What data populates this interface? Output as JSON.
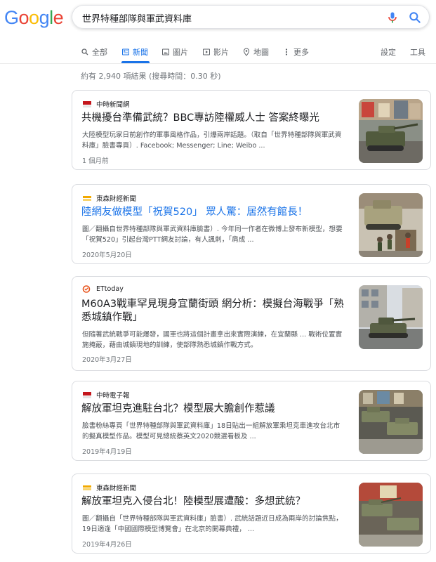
{
  "logo": {
    "letters": [
      "G",
      "o",
      "o",
      "g",
      "l",
      "e"
    ],
    "colors": [
      "#4285F4",
      "#EA4335",
      "#FBBC05",
      "#4285F4",
      "#34A853",
      "#EA4335"
    ]
  },
  "search": {
    "query": "世界特種部隊與軍武資料庫"
  },
  "tabs": {
    "all": "全部",
    "news": "新聞",
    "images": "圖片",
    "videos": "影片",
    "maps": "地圖",
    "more": "更多",
    "settings": "設定",
    "tools": "工具"
  },
  "stats": "約有 2,940 項結果 (搜尋時間：0.30 秒)",
  "results": [
    {
      "source": "中時新聞網",
      "title": "共機擾台準備武統？BBC專訪陸權威人士 答案終曝光",
      "snippet": "大陸模型玩家日前創作的軍事風格作品，引爆兩岸話題。（取自「世界特種部隊與軍武資料庫」臉書專頁）. Facebook; Messenger; Line; Weibo ...",
      "date": "1 個月前"
    },
    {
      "source": "東森財經新聞",
      "title": "陸網友做模型「祝賀520」 眾人驚：居然有館長！",
      "snippet": "圖／翻攝自世界特種部隊與軍武資料庫臉書）. 今年同一作者在微博上發布新模型，想要「祝賀520」引起台灣PTT網友討論，有人諷刺，「肩成 ...",
      "date": "2020年5月20日"
    },
    {
      "source": "ETtoday",
      "title": "M60A3戰車罕見現身宜蘭街頭 網分析：模擬台海戰爭「熟悉城鎮作戰」",
      "snippet": "但隨著武統戰爭可能爆發，國軍也將這個計畫拿出來實際演練，在宜蘭縣 ... 戰術位置實施掩蔽，藉由城鎮現地的訓練，使部隊熟悉城鎮作戰方式。",
      "date": "2020年3月27日"
    },
    {
      "source": "中時電子報",
      "title": "解放軍坦克進駐台北？模型展大膽創作惹議",
      "snippet": "臉書粉絲專頁「世界特種部隊與軍武資料庫」18日貼出一組解放軍乘坦克車進攻台北市的擬真模型作品。模型可見總統蔡英文2020競選看板及 ...",
      "date": "2019年4月19日"
    },
    {
      "source": "東森財經新聞",
      "title": "解放軍坦克入侵台北！陸模型展遭酸：多想武統？",
      "snippet": "圖／翻攝自「世界特種部隊與軍武資料庫」臉書）. 武統話題近日成為兩岸的討論焦點，19日適逢「中國國際模型博覽會」在北京的開幕典禮， ...",
      "date": "2019年4月26日"
    }
  ]
}
